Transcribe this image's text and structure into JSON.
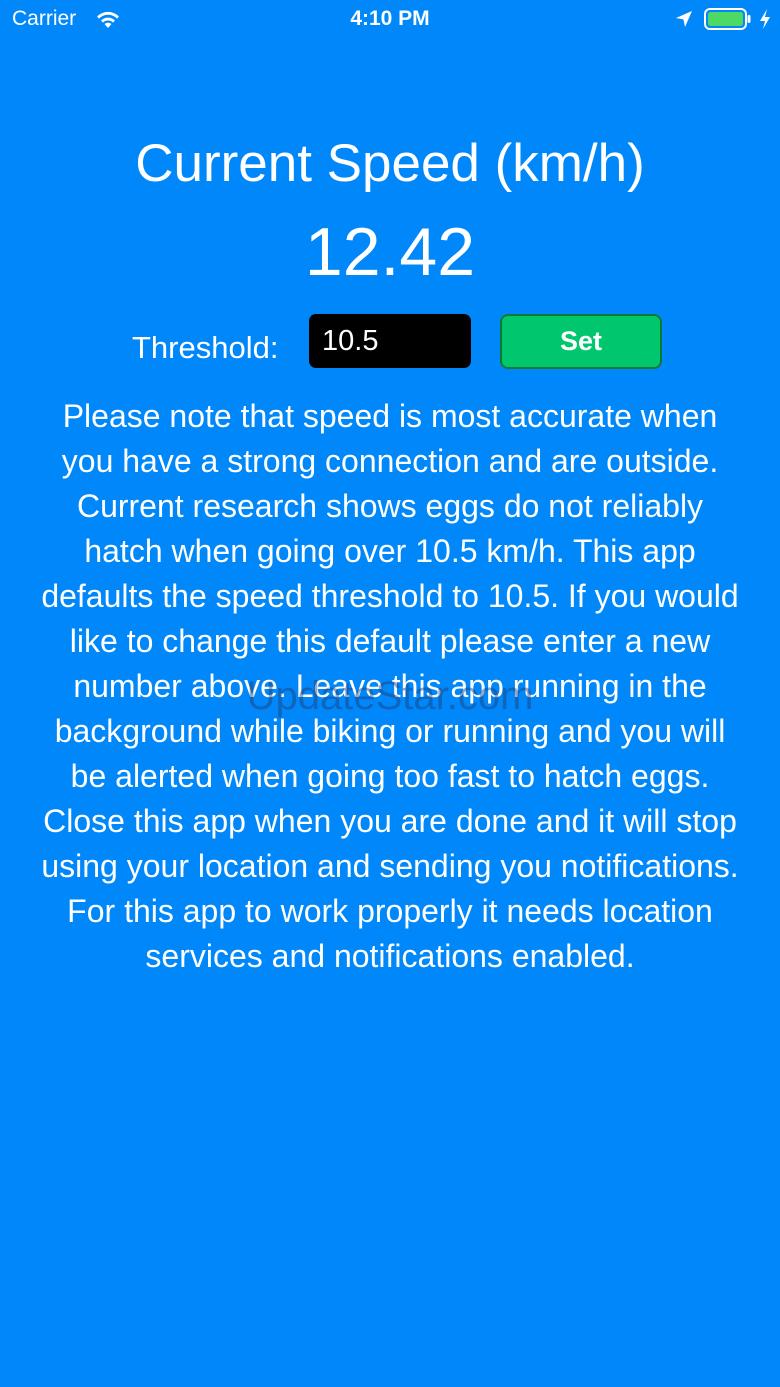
{
  "status_bar": {
    "carrier": "Carrier",
    "time": "4:10 PM",
    "icons": [
      "wifi-icon",
      "location-icon",
      "battery-icon",
      "charge-icon"
    ],
    "battery_color": "#4cd964"
  },
  "main": {
    "title": "Current Speed (km/h)",
    "speed_value": "12.42",
    "threshold_label": "Threshold:",
    "threshold_value": "10.5",
    "set_button_label": "Set",
    "note": "Please note that speed is most accurate when you have a strong connection and are outside. Current research shows eggs do not reliably hatch when going over 10.5 km/h. This app defaults the speed threshold to 10.5. If you would like to change this default please enter a new number above. Leave this app running in the background while biking or running and you will be alerted when going too fast to hatch eggs. Close this app when you are done and it will stop using your location and sending you notifications. For this app to work properly it needs location services and notifications enabled."
  },
  "watermark": "UpdateStar.com",
  "colors": {
    "background": "#0088fb",
    "button": "#00c66e",
    "input_background": "#000000"
  }
}
